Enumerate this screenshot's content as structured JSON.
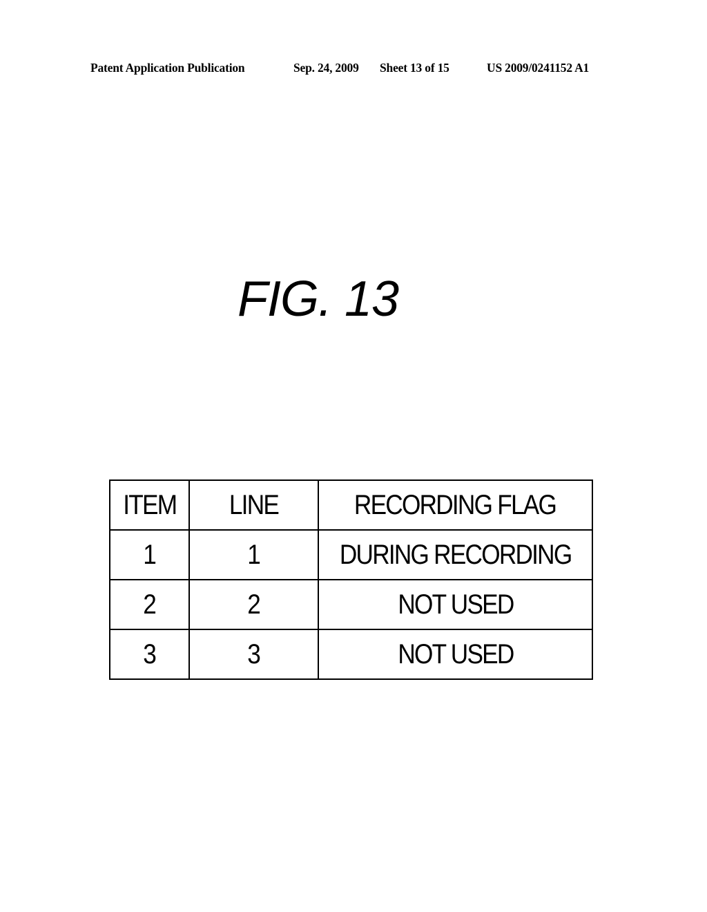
{
  "header": {
    "publication": "Patent Application Publication",
    "date": "Sep. 24, 2009",
    "sheet": "Sheet 13 of 15",
    "number": "US 2009/0241152 A1"
  },
  "figure": {
    "title": "FIG. 13"
  },
  "table": {
    "columns": [
      "ITEM",
      "LINE",
      "RECORDING FLAG"
    ],
    "rows": [
      [
        "1",
        "1",
        "DURING RECORDING"
      ],
      [
        "2",
        "2",
        "NOT USED"
      ],
      [
        "3",
        "3",
        "NOT USED"
      ]
    ]
  }
}
